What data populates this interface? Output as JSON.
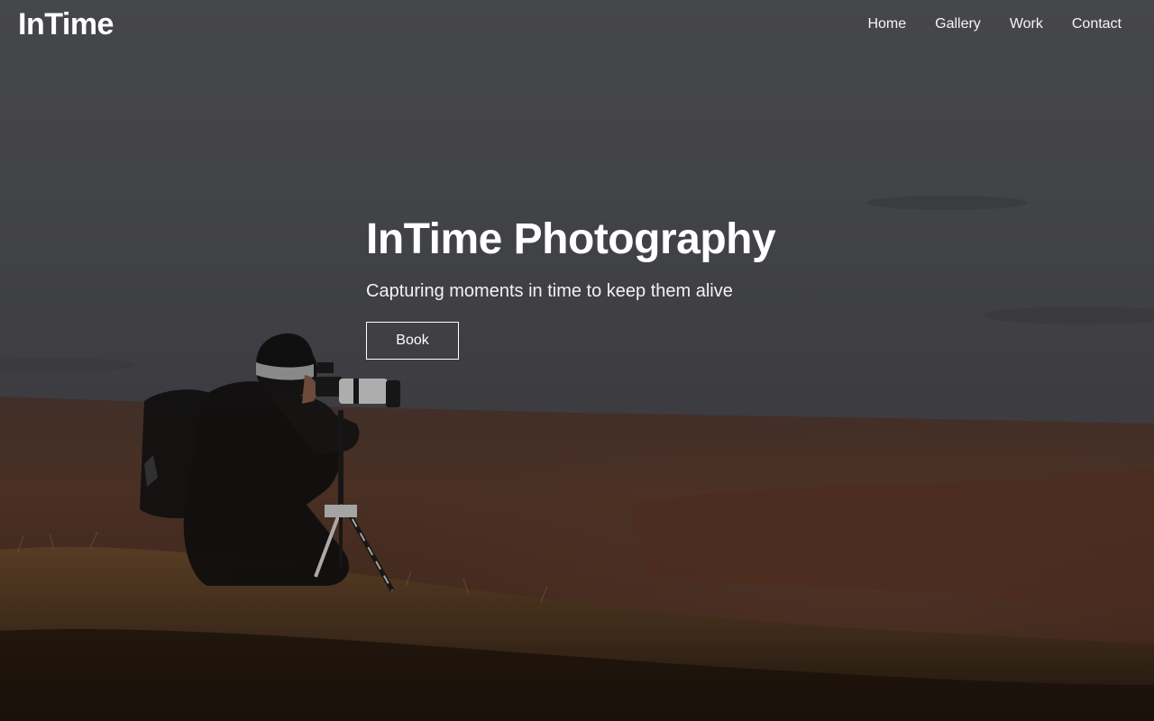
{
  "header": {
    "logo": "InTime",
    "nav": [
      {
        "label": "Home"
      },
      {
        "label": "Gallery"
      },
      {
        "label": "Work"
      },
      {
        "label": "Contact"
      }
    ]
  },
  "hero": {
    "title": "InTime Photography",
    "subtitle": "Capturing moments in time to keep them alive",
    "cta_label": "Book",
    "background": "photographer-with-camera-on-tripod-in-field"
  },
  "colors": {
    "text": "#ffffff",
    "sky": "#5a5b5e",
    "field": "#5b3a2a",
    "grass": "#6b4a2a"
  }
}
